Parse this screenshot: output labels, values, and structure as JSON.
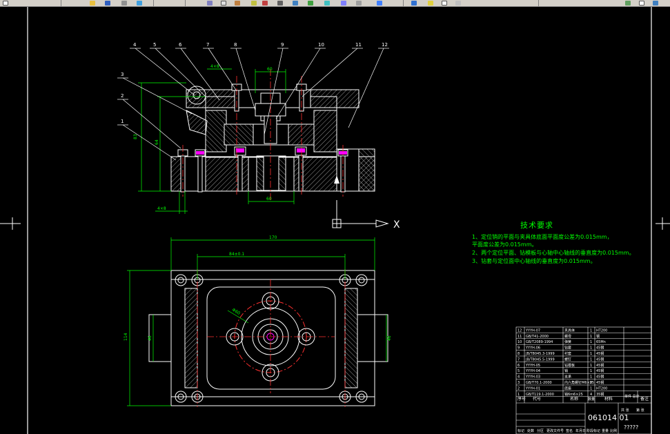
{
  "balloons": [
    "1",
    "2",
    "3",
    "4",
    "5",
    "6",
    "7",
    "8",
    "9",
    "10",
    "11",
    "12"
  ],
  "dims": {
    "top_width": "60",
    "left_bolt": "4×8",
    "height_total": "83",
    "height_inner": "64",
    "bottom_center": "60",
    "bottom_left": "4×8",
    "plan_width": "170",
    "plan_hole_spacing": "84±0.1",
    "plan_height": "114",
    "plan_left_inner": "46",
    "plan_right_inner": "46",
    "plan_diam": "Φ60"
  },
  "ucs_label": "X",
  "tech_req": {
    "title": "技术要求",
    "lines": [
      "1、定位销的平面与夹具体底面平面度公差为0.015mm，",
      "   平面度公差为0.015mm。",
      "2、两个定位平面、钻模板与心轴中心轴线的垂直度为0.015mm。",
      "3、钻套与定位面中心轴线的垂直度为0.015mm。"
    ]
  },
  "title_block": {
    "drawing_no": "061014 01",
    "name_placeholder": "?????",
    "rows": [
      {
        "no": "12",
        "code": "YYYH-07",
        "name": "夹具体",
        "qty": "1",
        "mat": "HT200"
      },
      {
        "no": "11",
        "code": "GB/T41-2000",
        "name": "螺母",
        "qty": "1",
        "mat": "钢"
      },
      {
        "no": "10",
        "code": "GB/T2089-1994",
        "name": "弹簧",
        "qty": "1",
        "mat": "65Mn"
      },
      {
        "no": "9",
        "code": "YYYH-06",
        "name": "钻套",
        "qty": "1",
        "mat": "45钢"
      },
      {
        "no": "8",
        "code": "JB/T8045.3-1999",
        "name": "衬套",
        "qty": "1",
        "mat": "45钢"
      },
      {
        "no": "7",
        "code": "JB/T8045.5-1999",
        "name": "螺钉",
        "qty": "1",
        "mat": "45钢"
      },
      {
        "no": "6",
        "code": "YYYH-05",
        "name": "钻模板",
        "qty": "1",
        "mat": "45钢"
      },
      {
        "no": "5",
        "code": "YYYH-04",
        "name": "销",
        "qty": "1",
        "mat": "45钢"
      },
      {
        "no": "4",
        "code": "YYYH-03",
        "name": "支承",
        "qty": "1",
        "mat": "45钢"
      },
      {
        "no": "3",
        "code": "GB/T70.1-2000",
        "name": "内六角螺钉M6×25",
        "qty": "8",
        "mat": "45钢"
      },
      {
        "no": "2",
        "code": "YYYH-01",
        "name": "底座",
        "qty": "1",
        "mat": "HT200"
      },
      {
        "no": "1",
        "code": "GB/T119.1-2000",
        "name": "销6m6×25",
        "qty": "4",
        "mat": "35钢"
      }
    ],
    "header": {
      "no": "序号",
      "code": "代号",
      "name": "名称",
      "qty": "数量",
      "mat": "材料",
      "wt": "单件 总计",
      "note": "备注"
    },
    "bottom_labels": [
      "标记",
      "处数",
      "分区",
      "更改文件号",
      "签名",
      "年月日"
    ],
    "scale_labels": [
      "阶段标记",
      "重量",
      "比例"
    ],
    "sheet_labels": [
      "共 张",
      "第 张"
    ]
  }
}
